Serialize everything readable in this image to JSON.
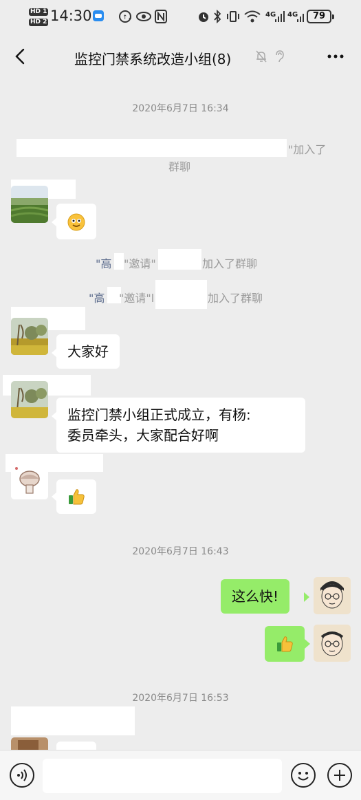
{
  "status_bar": {
    "hd1": "HD 1",
    "hd2": "HD 2",
    "time": "14:30",
    "signal_1": "4G",
    "signal_2": "4G",
    "battery": "79"
  },
  "nav": {
    "title": "监控门禁系统改造小组(8)"
  },
  "chat": {
    "timestamp_1": "2020年6月7日 16:34",
    "system_join_1_line1": "\"加入了",
    "system_join_1_line2": "群聊",
    "system_invite_1": {
      "prefix": "\"高",
      "mid": "\"邀请\"",
      "suffix": "加入了群聊"
    },
    "system_invite_2": {
      "prefix": "\"高",
      "mid": "\"邀请\"l",
      "suffix": "加入了群聊"
    },
    "message_2": "大家好",
    "message_3_line1": "监控门禁小组正式成立，有杨:",
    "message_3_line2": "委员牵头，大家配合好啊",
    "timestamp_2": "2020年6月7日 16:43",
    "message_5": "这么快!",
    "timestamp_3": "2020年6月7日 16:53"
  },
  "icons": [
    "back-icon",
    "mute-icon",
    "ear-icon",
    "more-icon",
    "smile-emoji-icon",
    "thumbs-up-icon",
    "voice-icon",
    "emoji-icon",
    "plus-icon"
  ],
  "colors": {
    "background": "#ededed",
    "own_bubble": "#95ec69",
    "other_bubble": "#ffffff"
  }
}
